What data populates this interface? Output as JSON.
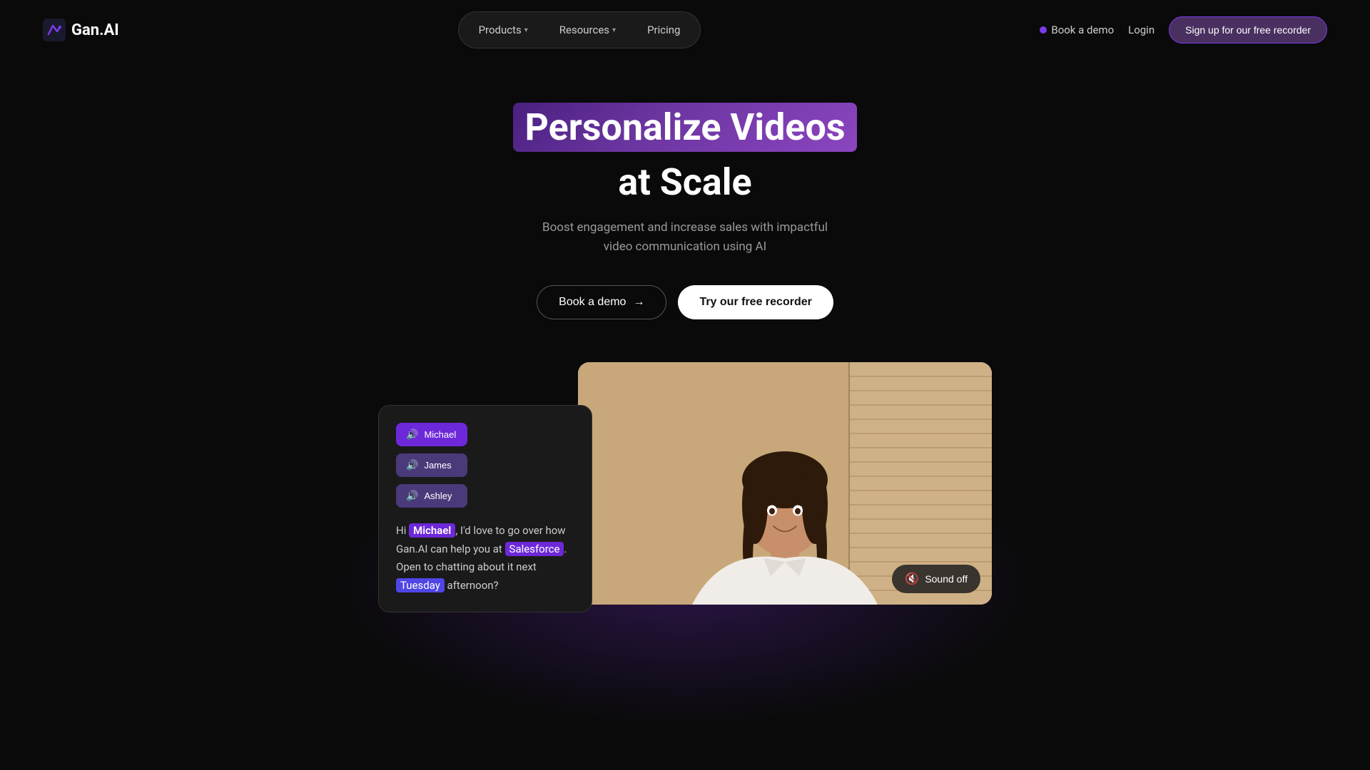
{
  "nav": {
    "logo_text": "Gan.AI",
    "products_label": "Products",
    "resources_label": "Resources",
    "pricing_label": "Pricing",
    "book_demo_label": "Book a demo",
    "login_label": "Login",
    "signup_label": "Sign up for our free recorder"
  },
  "hero": {
    "title_highlight": "Personalize Videos",
    "title_main": "at Scale",
    "subtitle": "Boost engagement and increase sales with impactful video communication using AI",
    "btn_demo": "Book a demo",
    "btn_recorder": "Try our free recorder"
  },
  "personalization": {
    "person1": "Michael",
    "person2": "James",
    "person3": "Ashley",
    "speech_pre": "Hi ",
    "speech_name": "Michael",
    "speech_mid1": ", I'd love to go over how Gan.AI can help you at ",
    "speech_company": "Salesforce",
    "speech_mid2": ". Open to chatting about it next ",
    "speech_day": "Tuesday",
    "speech_end": " afternoon?"
  },
  "video": {
    "sound_off_label": "Sound off"
  }
}
